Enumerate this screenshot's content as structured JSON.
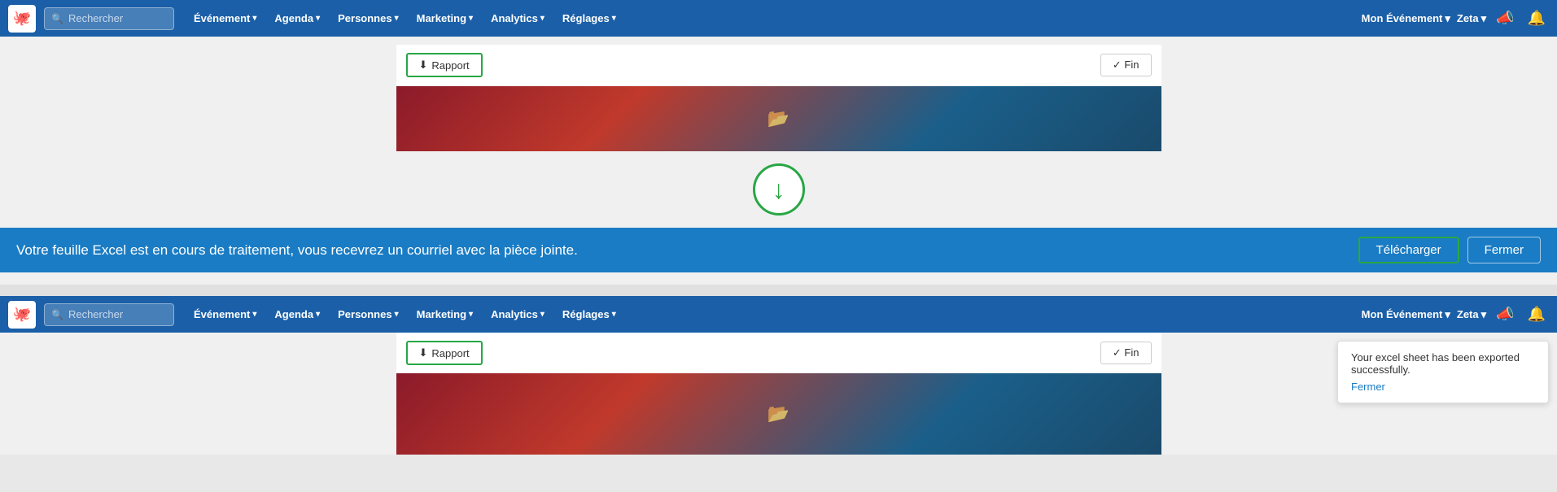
{
  "navbar_top": {
    "logo_emoji": "🐙",
    "search_placeholder": "Rechercher",
    "nav_items": [
      {
        "label": "Événement",
        "id": "evenement"
      },
      {
        "label": "Agenda",
        "id": "agenda"
      },
      {
        "label": "Personnes",
        "id": "personnes"
      },
      {
        "label": "Marketing",
        "id": "marketing"
      },
      {
        "label": "Analytics",
        "id": "analytics"
      },
      {
        "label": "Réglages",
        "id": "reglages"
      }
    ],
    "right_items": [
      {
        "label": "Mon Événement",
        "id": "mon-evenement"
      },
      {
        "label": "Zeta",
        "id": "zeta"
      }
    ]
  },
  "toolbar_top": {
    "rapport_label": "Rapport",
    "fin_label": "✓ Fin"
  },
  "download_section": {},
  "notification_banner": {
    "text": "Votre feuille Excel est en cours de traitement, vous recevrez un courriel avec la pièce jointe.",
    "telecharger_label": "Télécharger",
    "fermer_label": "Fermer"
  },
  "navbar_bottom": {
    "logo_emoji": "🐙",
    "search_placeholder": "Rechercher",
    "nav_items": [
      {
        "label": "Événement",
        "id": "evenement2"
      },
      {
        "label": "Agenda",
        "id": "agenda2"
      },
      {
        "label": "Personnes",
        "id": "personnes2"
      },
      {
        "label": "Marketing",
        "id": "marketing2"
      },
      {
        "label": "Analytics",
        "id": "analytics2"
      },
      {
        "label": "Réglages",
        "id": "reglages2"
      }
    ],
    "right_items": [
      {
        "label": "Mon Événement",
        "id": "mon-evenement2"
      },
      {
        "label": "Zeta",
        "id": "zeta2"
      }
    ]
  },
  "toolbar_bottom": {
    "rapport_label": "Rapport",
    "fin_label": "✓ Fin"
  },
  "toast": {
    "text": "Your excel sheet has been exported successfully.",
    "fermer_label": "Fermer"
  },
  "folder_icon": "📂",
  "megaphone_icon": "📣",
  "bell_icon": "🔔"
}
